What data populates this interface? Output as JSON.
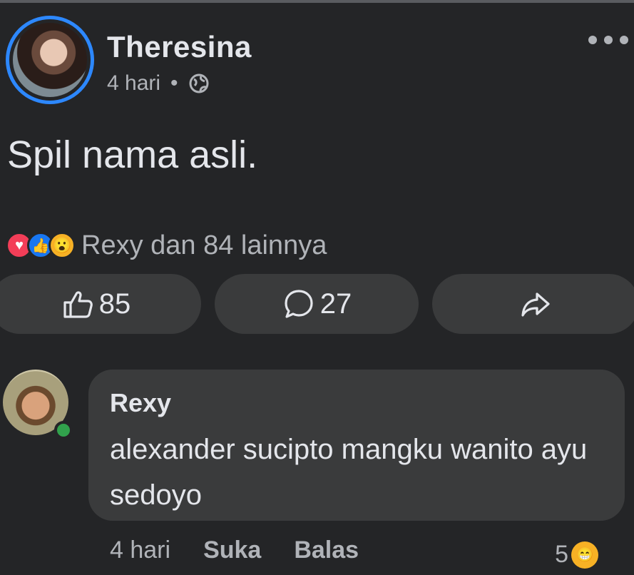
{
  "post": {
    "author": "Theresina",
    "time": "4 hari",
    "separator": "•",
    "text": "Spil nama asli.",
    "reactions_summary": "Rexy dan 84 lainnya",
    "reaction_icons": [
      "love-icon",
      "like-icon",
      "wow-icon"
    ],
    "like_count": "85",
    "comment_count": "27"
  },
  "comment": {
    "author": "Rexy",
    "text": "alexander sucipto mangku wanito ayu sedoyo",
    "time": "4 hari",
    "like_label": "Suka",
    "reply_label": "Balas",
    "reaction_count": "5",
    "reaction_icon": "haha-icon"
  },
  "colors": {
    "background": "#242527",
    "surface": "#3a3b3c",
    "accent": "#2d88ff",
    "online": "#31a24c"
  }
}
